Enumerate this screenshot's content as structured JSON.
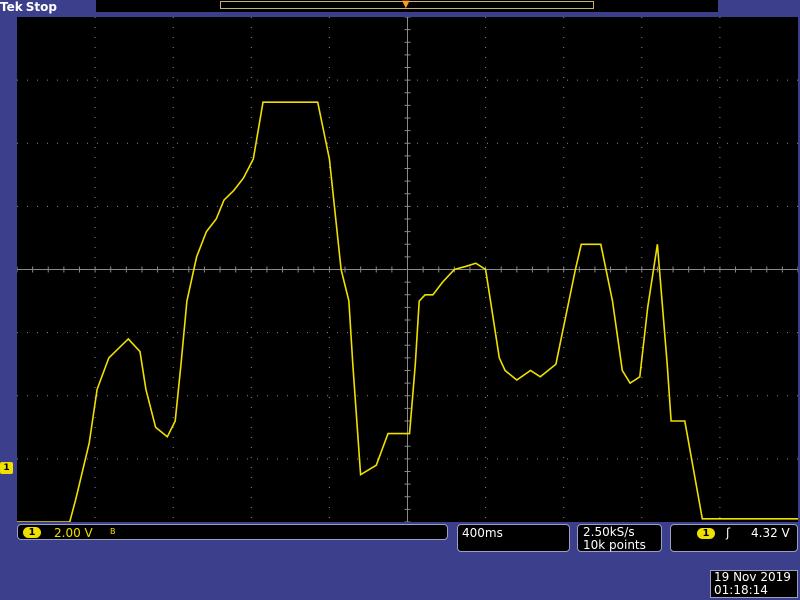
{
  "header": {
    "brand": "Tek",
    "status": "Stop"
  },
  "colors": {
    "trace": "#f0e000",
    "screen": "#000000",
    "frame": "#3b3f8c",
    "grid": "#8a8a8a",
    "trigger_marker": "#ff9a1e"
  },
  "channel1": {
    "marker_label": "1",
    "badge_label": "1",
    "volts_per_div": "2.00 V",
    "bandwidth_icon": "B",
    "ground_level_volts": -8
  },
  "timebase": {
    "label": "400ms"
  },
  "acquisition": {
    "sample_rate": "2.50kS/s",
    "record_length": "10k points"
  },
  "trigger": {
    "source_label": "1",
    "slope_icon": "rising-edge-icon",
    "slope_glyph": "ʃ",
    "level": "4.32 V"
  },
  "datetime": {
    "date": "19 Nov 2019",
    "time": "01:18:14"
  },
  "chart_data": {
    "type": "line",
    "title": "",
    "xlabel": "",
    "ylabel": "",
    "x_unit": "s",
    "y_unit": "V",
    "xlim": [
      -2.0,
      2.0
    ],
    "ylim": [
      -8.0,
      8.0
    ],
    "grid": true,
    "series": [
      {
        "values_x": [
          -2.0,
          -1.73,
          -1.7,
          -1.63,
          -1.59,
          -1.53,
          -1.43,
          -1.37,
          -1.34,
          -1.29,
          -1.23,
          -1.19,
          -1.16,
          -1.13,
          -1.08,
          -1.03,
          -0.98,
          -0.94,
          -0.89,
          -0.84,
          -0.79,
          -0.74,
          -0.69,
          -0.63,
          -0.58,
          -0.53,
          -0.46,
          -0.4,
          -0.34,
          -0.3,
          -0.28,
          -0.24,
          -0.16,
          -0.1,
          -0.08,
          -0.04,
          0.01,
          0.02,
          0.04,
          0.06,
          0.09,
          0.13,
          0.18,
          0.24,
          0.3,
          0.35,
          0.4,
          0.43,
          0.47,
          0.5,
          0.56,
          0.63,
          0.68,
          0.76,
          0.86,
          0.89,
          0.91,
          0.94,
          0.99,
          1.05,
          1.1,
          1.14,
          1.19,
          1.23,
          1.28,
          1.33,
          1.35,
          1.42,
          1.51,
          1.54,
          1.58,
          1.58,
          1.59,
          1.59,
          1.6,
          1.61,
          1.62,
          2.0
        ],
        "values_y": [
          -8.0,
          -8.0,
          -7.3,
          -5.5,
          -3.8,
          -2.8,
          -2.2,
          -2.6,
          -3.8,
          -5.0,
          -5.3,
          -4.8,
          -3.0,
          -1.0,
          0.4,
          1.2,
          1.6,
          2.2,
          2.5,
          2.9,
          3.5,
          5.3,
          5.3,
          5.3,
          5.3,
          5.3,
          5.3,
          3.5,
          0.0,
          -1.0,
          -3.0,
          -6.5,
          -6.2,
          -5.2,
          -5.2,
          -5.2,
          -5.2,
          -4.5,
          -3.0,
          -1.0,
          -0.8,
          -0.8,
          -0.4,
          0.0,
          0.1,
          0.2,
          0.0,
          -1.2,
          -2.8,
          -3.2,
          -3.5,
          -3.2,
          -3.4,
          -3.0,
          0.0,
          0.8,
          0.8,
          0.8,
          0.8,
          -1.0,
          -3.2,
          -3.6,
          -3.4,
          -1.2,
          0.8,
          -3.0,
          -4.8,
          -4.8,
          -7.9,
          -7.9,
          -7.9,
          -7.9,
          -7.9,
          -7.9,
          -7.9,
          -7.9,
          -7.9,
          -7.9
        ]
      }
    ]
  }
}
